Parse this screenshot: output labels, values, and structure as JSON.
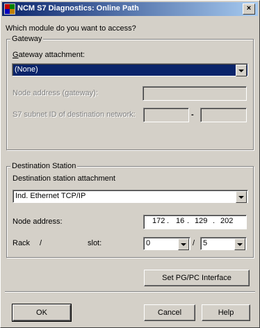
{
  "window": {
    "title": "NCM S7 Diagnostics: Online Path",
    "close_label": "×"
  },
  "prompt": "Which module do you want to access?",
  "gateway": {
    "group_label": "Gateway",
    "attachment_label": "Gateway attachment:",
    "attachment_value": "(None)",
    "node_address_label": "Node address (gateway):",
    "node_address_value": "",
    "subnet_label": "S7 subnet ID of destination network:",
    "subnet_left": "",
    "subnet_sep": "-",
    "subnet_right": ""
  },
  "destination": {
    "group_label": "Destination Station",
    "attachment_label": "Destination station attachment",
    "attachment_value": "Ind. Ethernet TCP/IP",
    "node_address_label": "Node address:",
    "ip": [
      "172",
      "16",
      "129",
      "202"
    ],
    "ip_dot": ".",
    "rack_label": "Rack",
    "rack_slash": "/",
    "slot_label": "slot:",
    "rack_value": "0",
    "slot_slash": "/",
    "slot_value": "5"
  },
  "buttons": {
    "set_pgpc": "Set PG/PC Interface",
    "ok": "OK",
    "cancel": "Cancel",
    "help": "Help"
  },
  "colors": {
    "title_gradient_start": "#0a246a",
    "selection": "#0a246a",
    "face": "#d4d0c8"
  }
}
